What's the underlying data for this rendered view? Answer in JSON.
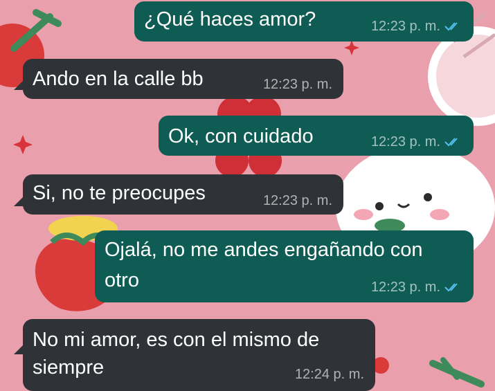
{
  "chat": {
    "messages": [
      {
        "text": "¿Qué haces amor?",
        "time": "12:23 p. m.",
        "direction": "outgoing",
        "status": "read-double-check-icon"
      },
      {
        "text": "Ando en la calle bb",
        "time": "12:23 p. m.",
        "direction": "incoming"
      },
      {
        "text": "Ok, con cuidado",
        "time": "12:23 p. m.",
        "direction": "outgoing",
        "status": "read-double-check-icon"
      },
      {
        "text": "Si, no te preocupes",
        "time": "12:23 p. m.",
        "direction": "incoming"
      },
      {
        "line1": "Ojalá, no me andes engañando con",
        "line2": "otro",
        "time": "12:23 p. m.",
        "direction": "outgoing",
        "status": "read-double-check-icon"
      },
      {
        "line1": "No mi amor, es con el mismo de",
        "line2": "siempre",
        "time": "12:24 p. m.",
        "direction": "incoming"
      }
    ]
  },
  "colors": {
    "wallpaper": "#e9a0ac",
    "outgoing_bubble": "#0e5c54",
    "incoming_bubble": "#2f3237",
    "read_ticks": "#53bdeb"
  }
}
